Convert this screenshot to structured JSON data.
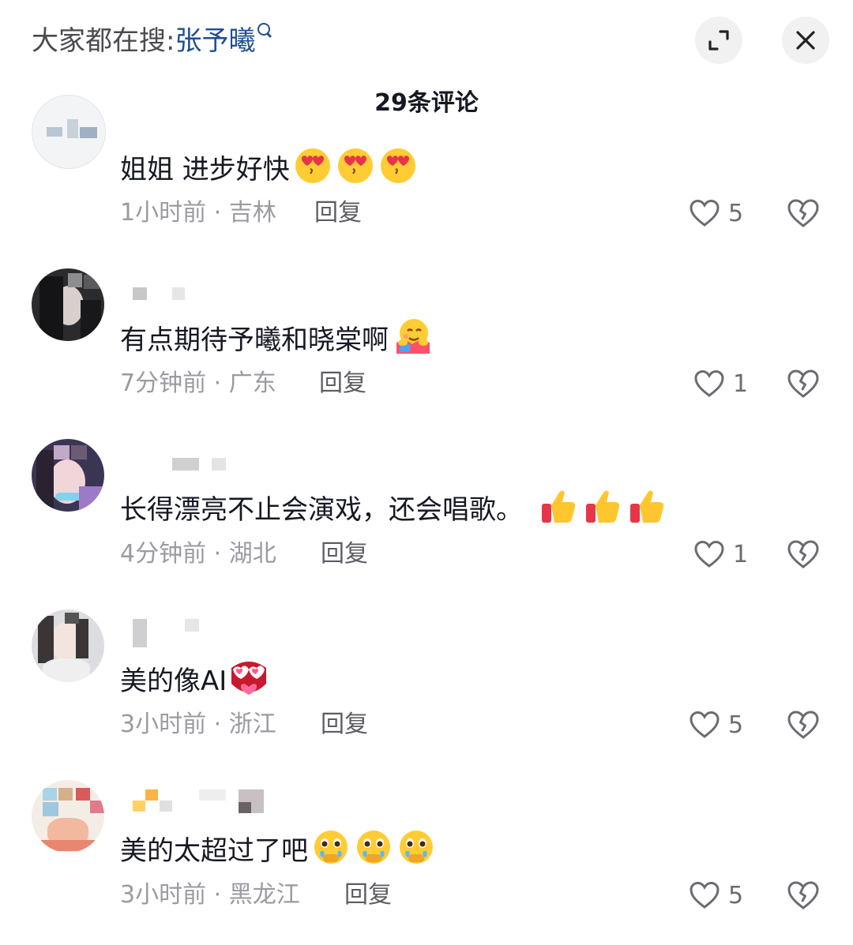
{
  "header": {
    "search_prefix": "大家都在搜:",
    "search_term": "张予曦",
    "comment_count": "29条评论"
  },
  "comments": [
    {
      "text": "姐姐 进步好快",
      "emojis": [
        "heart-eyes-kiss-emoji",
        "heart-eyes-kiss-emoji",
        "heart-eyes-kiss-emoji"
      ],
      "time_location": "1小时前 · 吉林",
      "reply": "回复",
      "likes": "5"
    },
    {
      "text": "有点期待予曦和晓棠啊",
      "emojis": [
        "hug-emoji"
      ],
      "time_location": "7分钟前 · 广东",
      "reply": "回复",
      "likes": "1"
    },
    {
      "text": "长得漂亮不止会演戏，还会唱歌。",
      "emojis": [
        "thumbs-up-emoji",
        "thumbs-up-emoji",
        "thumbs-up-emoji"
      ],
      "time_location": "4分钟前 · 湖北",
      "reply": "回复",
      "likes": "1"
    },
    {
      "text": "美的像AI",
      "emojis": [
        "heart-eyes-mask-emoji"
      ],
      "time_location": "3小时前 · 浙江",
      "reply": "回复",
      "likes": "5"
    },
    {
      "text": "美的太超过了吧",
      "emojis": [
        "tearful-emoji",
        "tearful-emoji",
        "tearful-emoji"
      ],
      "time_location": "3小时前 · 黑龙江",
      "reply": "回复",
      "likes": "5"
    }
  ],
  "icons": {
    "expand": "expand-icon",
    "close": "close-icon",
    "like": "heart-outline-icon",
    "dislike": "broken-heart-icon"
  },
  "colors": {
    "search_term": "#1f4f8f",
    "meta_text": "#9a9ba1",
    "primary_text": "#161823"
  }
}
